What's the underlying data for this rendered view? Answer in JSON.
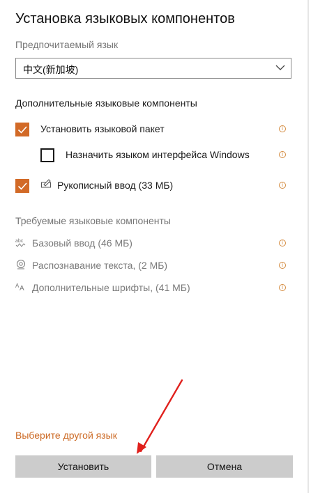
{
  "dialog": {
    "title": "Установка языковых компонентов",
    "preferred_label": "Предпочитаемый язык",
    "preferred_value": "中文(新加坡)",
    "optional_header": "Дополнительные языковые компоненты",
    "optional_items": [
      {
        "label": "Установить языковой пакет",
        "checked": true
      },
      {
        "label": "Назначить языком интерфейса Windows",
        "checked": false
      },
      {
        "label": "Рукописный ввод (33 МБ)",
        "checked": true,
        "icon": "handwriting-icon"
      }
    ],
    "required_header": "Требуемые языковые компоненты",
    "required_items": [
      {
        "label": "Базовый ввод (46 МБ)",
        "icon": "abc-typing-icon"
      },
      {
        "label": "Распознавание текста, (2 МБ)",
        "icon": "ocr-icon"
      },
      {
        "label": "Дополнительные шрифты, (41 МБ)",
        "icon": "font-icon"
      }
    ],
    "other_language_link": "Выберите другой язык",
    "install_button": "Установить",
    "cancel_button": "Отмена"
  },
  "colors": {
    "accent": "#d26a27",
    "link": "#cc6a25",
    "annotation_arrow": "#e0201c"
  }
}
